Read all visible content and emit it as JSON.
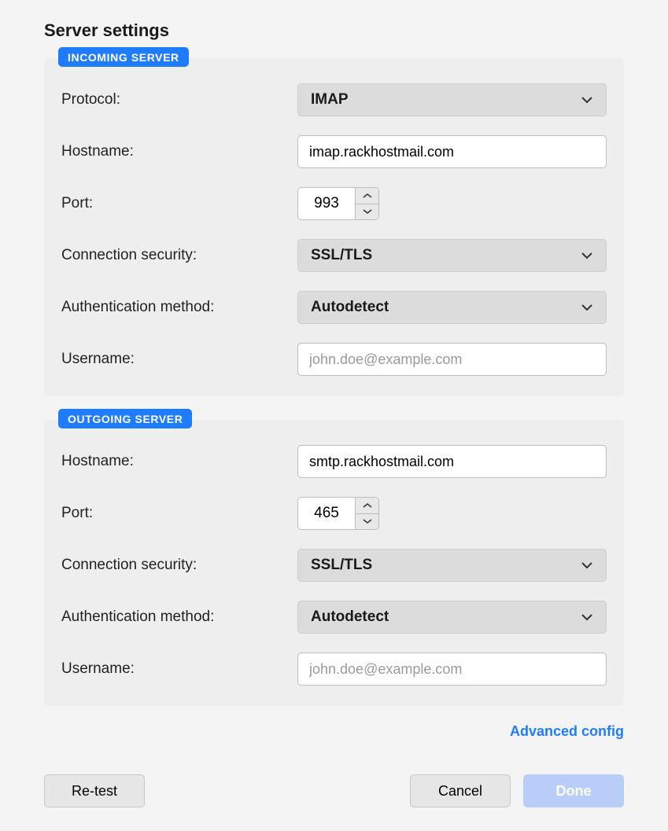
{
  "title": "Server settings",
  "incoming": {
    "badge": "INCOMING SERVER",
    "protocol_label": "Protocol:",
    "protocol_value": "IMAP",
    "hostname_label": "Hostname:",
    "hostname_value": "imap.rackhostmail.com",
    "port_label": "Port:",
    "port_value": "993",
    "security_label": "Connection security:",
    "security_value": "SSL/TLS",
    "auth_label": "Authentication method:",
    "auth_value": "Autodetect",
    "username_label": "Username:",
    "username_placeholder": "john.doe@example.com"
  },
  "outgoing": {
    "badge": "OUTGOING SERVER",
    "hostname_label": "Hostname:",
    "hostname_value": "smtp.rackhostmail.com",
    "port_label": "Port:",
    "port_value": "465",
    "security_label": "Connection security:",
    "security_value": "SSL/TLS",
    "auth_label": "Authentication method:",
    "auth_value": "Autodetect",
    "username_label": "Username:",
    "username_placeholder": "john.doe@example.com"
  },
  "links": {
    "advanced": "Advanced config"
  },
  "buttons": {
    "retest": "Re-test",
    "cancel": "Cancel",
    "done": "Done"
  }
}
